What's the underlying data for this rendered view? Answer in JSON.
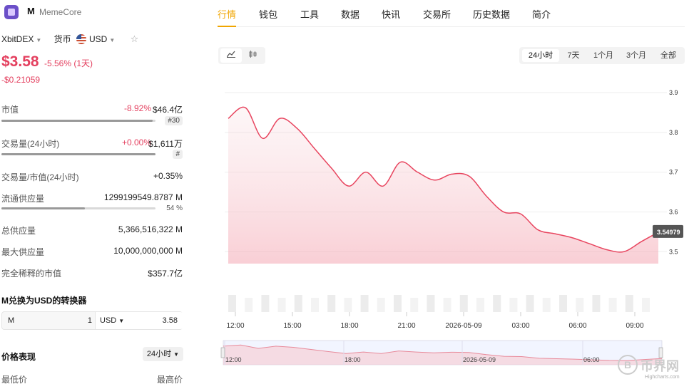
{
  "coin": {
    "symbol": "M",
    "name": "MemeCore"
  },
  "exchange": {
    "name": "XbitDEX",
    "currency_label": "货币",
    "currency": "USD"
  },
  "price": {
    "value": "$3.58",
    "change_pct": "-5.56% (1天)",
    "change_abs": "-$0.21059"
  },
  "stats": [
    {
      "label": "市值",
      "pct": "-8.92%",
      "value": "$46.4亿",
      "rank": "#30",
      "bar": 0.98
    },
    {
      "label": "交易量(24小时)",
      "pct": "+0.00%",
      "value": "$1,611万",
      "rank": "#",
      "bar": 1.0
    },
    {
      "label": "交易量/市值(24小时)",
      "value": "+0.35%"
    },
    {
      "label": "流通供应量",
      "value": "1299199549.8787 M",
      "sub": "54 %",
      "bar": 0.54
    },
    {
      "label": "总供应量",
      "value": "5,366,516,322 M"
    },
    {
      "label": "最大供应量",
      "value": "10,000,000,000 M"
    },
    {
      "label": "完全稀释的市值",
      "value": "$357.7亿"
    }
  ],
  "converter": {
    "title": "M兑换为USD的转换器",
    "from": "M",
    "amount": "1",
    "to": "USD",
    "result": "3.58"
  },
  "performance": {
    "title": "价格表现",
    "range": "24小时",
    "low_label": "最低价",
    "high_label": "最高价"
  },
  "tabs": [
    "行情",
    "钱包",
    "工具",
    "数据",
    "快讯",
    "交易所",
    "历史数据",
    "简介"
  ],
  "chart_types": {
    "line_icon": "line-chart-icon",
    "candle_icon": "candlestick-icon"
  },
  "ranges": [
    "24小时",
    "7天",
    "1个月",
    "3个月",
    "全部"
  ],
  "colors": {
    "accent": "#f0a500",
    "down": "#e4405f",
    "line": "#e8455f"
  },
  "chart_data": {
    "type": "area",
    "x": [
      "11:45",
      "12:30",
      "13:30",
      "14:15",
      "15:00",
      "16:00",
      "17:00",
      "18:00",
      "18:45",
      "19:30",
      "20:15",
      "21:00",
      "22:00",
      "22:45",
      "23:30",
      "00:15",
      "01:00",
      "02:00",
      "03:00",
      "04:00",
      "05:00",
      "06:00",
      "07:00",
      "08:00",
      "09:00",
      "09:45",
      "10:30"
    ],
    "values": [
      3.835,
      3.862,
      3.785,
      3.835,
      3.81,
      3.76,
      3.71,
      3.665,
      3.7,
      3.665,
      3.725,
      3.7,
      3.68,
      3.695,
      3.69,
      3.64,
      3.6,
      3.595,
      3.555,
      3.545,
      3.535,
      3.52,
      3.505,
      3.5,
      3.525,
      3.549
    ],
    "last_label": "3.54979",
    "ylim": [
      3.47,
      3.9
    ],
    "yticks": [
      "3.9",
      "3.8",
      "3.7",
      "3.6",
      "3.5"
    ],
    "xticks": [
      "12:00",
      "15:00",
      "18:00",
      "21:00",
      "2026-05-09",
      "03:00",
      "06:00",
      "09:00"
    ],
    "navigator_ticks": [
      "12:00",
      "18:00",
      "2026-05-09",
      "06:00"
    ],
    "credit": "Highcharts.com",
    "grid": true,
    "volume": true
  },
  "watermark": "币界网"
}
